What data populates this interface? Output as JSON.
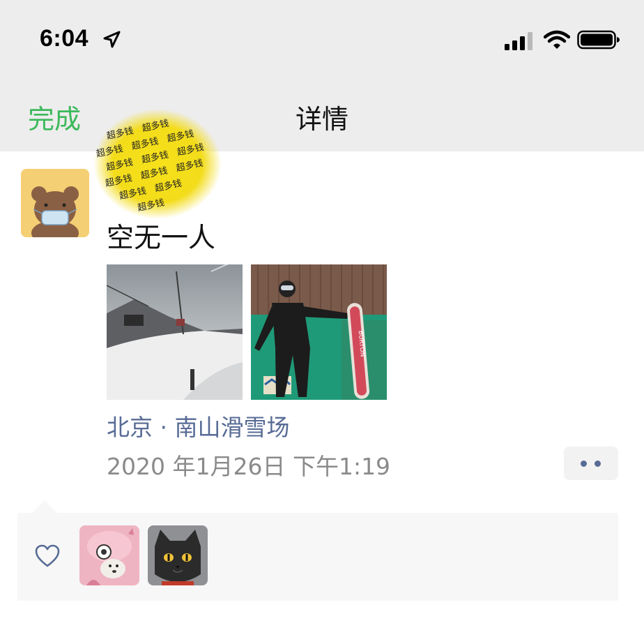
{
  "status_bar": {
    "time": "6:04",
    "icons": [
      "location-arrow-icon",
      "cellular-signal-icon",
      "wifi-icon",
      "battery-icon"
    ]
  },
  "nav": {
    "done_label": "完成",
    "title": "详情"
  },
  "post": {
    "author_avatar": "bear-with-mask-avatar",
    "sticker_text": "超多钱",
    "text": "空无一人",
    "photos": [
      "ski-resort-lift-photo",
      "snowboarder-burton-photo"
    ],
    "location": "北京 · 南山滑雪场",
    "timestamp": "2020 年1月26日 下午1:19"
  },
  "likes": {
    "icon": "heart-icon",
    "likers": [
      "pink-dog-avatar",
      "black-cat-avatar"
    ]
  },
  "colors": {
    "accent_green": "#3cb95b",
    "link_blue": "#576b95",
    "nav_bg": "#ededed",
    "likes_bg": "#f7f7f7"
  }
}
